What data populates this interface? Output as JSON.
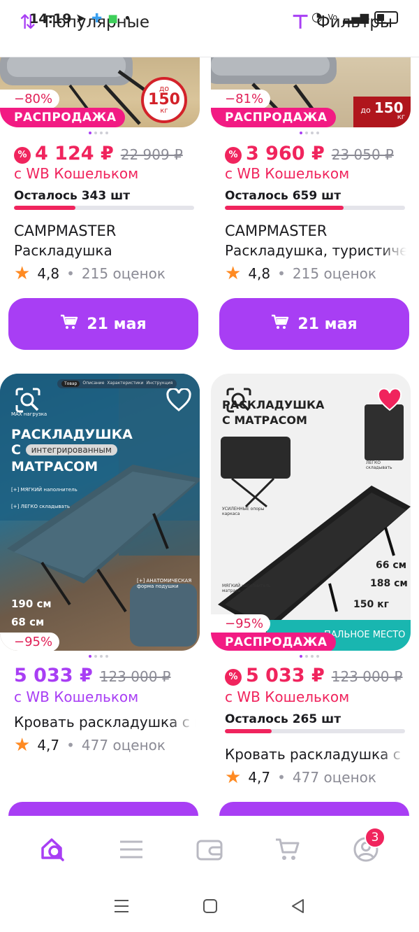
{
  "status_bar": {
    "time": "14:19",
    "network": "Vo"
  },
  "top_bar": {
    "sort_label": "Популярные",
    "filter_label": "Фильтры"
  },
  "cards": [
    {
      "discount": "−80%",
      "sale_label": "РАСПРОДАЖА",
      "image_badge": {
        "top": "до",
        "value": "150",
        "unit": "кг"
      },
      "price": "4 124 ₽",
      "old_price": "22 909 ₽",
      "wallet": "с WB Кошельком",
      "stock": "Осталось 343 шт",
      "stock_fraction": 0.34,
      "brand": "CAMPMASTER",
      "name": "Раскладушка",
      "rating": "4,8",
      "reviews": "215 оценок",
      "delivery": "21 мая"
    },
    {
      "discount": "−81%",
      "sale_label": "РАСПРОДАЖА",
      "image_badge": {
        "top": "до",
        "value": "150",
        "unit": "кг"
      },
      "price": "3 960 ₽",
      "old_price": "23 050 ₽",
      "wallet": "с WB Кошельком",
      "stock": "Осталось 659 шт",
      "stock_fraction": 0.66,
      "brand": "CAMPMASTER",
      "name": "Раскладушка, туристиче",
      "rating": "4,8",
      "reviews": "215 оценок",
      "delivery": "21 мая"
    },
    {
      "discount": "−95%",
      "image_title": [
        "РАСКЛАДУШКА",
        "С",
        "интегрированным",
        "МАТРАСОМ"
      ],
      "image_tabs": [
        "Товар",
        "Описание",
        "Характеристики",
        "Инструкция"
      ],
      "image_features": [
        "[+] МЯГКИЙ наполнитель",
        "[+] ЛЕГКО складывать",
        "[+] АНАТОМИЧЕСКАЯ форма подушки"
      ],
      "image_dims": [
        "190 см",
        "68 см"
      ],
      "image_load": "MAX нагрузка",
      "price": "5 033 ₽",
      "old_price": "123 000 ₽",
      "wallet": "с WB Кошельком",
      "name": "Кровать раскладушка с м",
      "rating": "4,7",
      "reviews": "477 оценок"
    },
    {
      "discount": "−95%",
      "sale_label": "РАСПРОДАЖА",
      "image_title": [
        "РАСКЛАДУШКА",
        "С МАТРАСОМ"
      ],
      "image_features": [
        "ЛЕГКО складывать",
        "УСИЛЕННЫЕ опоры каркаса",
        "МЯГКИЙ наполнитель матраса"
      ],
      "image_dims": [
        "66 см",
        "188 см",
        "150 кг"
      ],
      "image_footer": "ПАЛЬНОЕ МЕСТО",
      "price": "5 033 ₽",
      "old_price": "123 000 ₽",
      "wallet": "с WB Кошельком",
      "stock": "Осталось 265 шт",
      "stock_fraction": 0.26,
      "name": "Кровать раскладушка с м",
      "rating": "4,7",
      "reviews": "477 оценок"
    }
  ],
  "bottom_nav": {
    "items": [
      "home-search",
      "catalog",
      "wallet",
      "cart",
      "profile"
    ],
    "profile_badge": "3"
  },
  "colors": {
    "accent": "#a83ef4",
    "sale_pink": "#f21b83",
    "price_red": "#f0245d",
    "star": "#ff8a22"
  }
}
